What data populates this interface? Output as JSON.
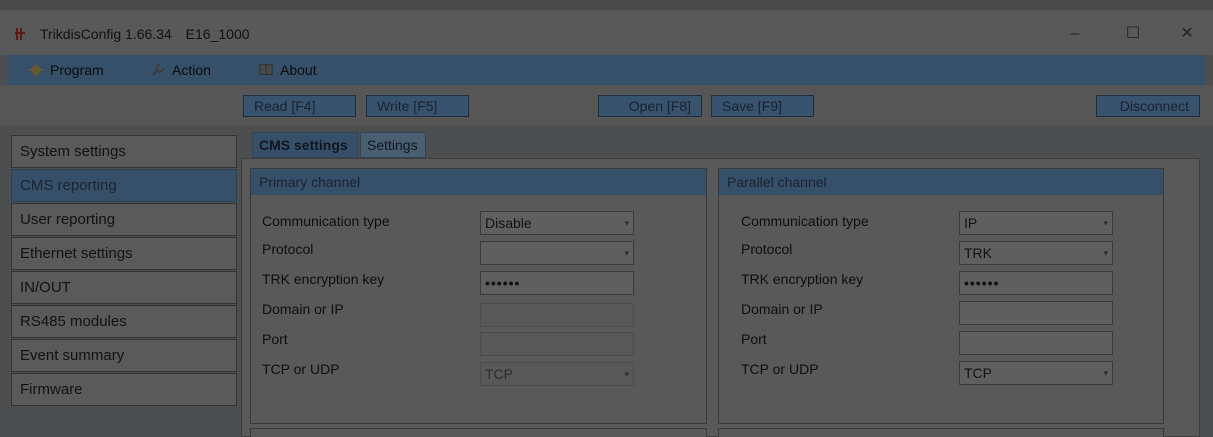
{
  "window": {
    "title": "TrikdisConfig 1.66.34",
    "device": "E16_1000",
    "controls": {
      "minimize": "–",
      "maximize": "☐",
      "close": "✕"
    }
  },
  "menu": {
    "program": "Program",
    "action": "Action",
    "about": "About"
  },
  "toolbar": {
    "read": "Read [F4]",
    "write": "Write [F5]",
    "open": "Open [F8]",
    "save": "Save [F9]",
    "disconnect": "Disconnect"
  },
  "sidebar": {
    "items": [
      {
        "label": "System settings"
      },
      {
        "label": "CMS reporting"
      },
      {
        "label": "User reporting"
      },
      {
        "label": "Ethernet settings"
      },
      {
        "label": "IN/OUT"
      },
      {
        "label": "RS485 modules"
      },
      {
        "label": "Event summary"
      },
      {
        "label": "Firmware"
      }
    ],
    "active_index": 1
  },
  "tabs": {
    "cms_settings": "CMS settings",
    "settings": "Settings"
  },
  "primary": {
    "title": "Primary channel",
    "labels": {
      "comm_type": "Communication type",
      "protocol": "Protocol",
      "enc_key": "TRK encryption key",
      "domain": "Domain or IP",
      "port": "Port",
      "tcp_udp": "TCP or UDP"
    },
    "values": {
      "comm_type": "Disable",
      "protocol": "",
      "enc_key": "••••••",
      "domain": "",
      "port": "",
      "tcp_udp": "TCP"
    }
  },
  "parallel": {
    "title": "Parallel channel",
    "labels": {
      "comm_type": "Communication type",
      "protocol": "Protocol",
      "enc_key": "TRK encryption key",
      "domain": "Domain or IP",
      "port": "Port",
      "tcp_udp": "TCP or UDP"
    },
    "values": {
      "comm_type": "IP",
      "protocol": "TRK",
      "enc_key": "••••••",
      "domain": "",
      "port": "",
      "tcp_udp": "TCP"
    }
  },
  "icons": {
    "app": "trikdis-app-icon",
    "program": "gear-icon",
    "action": "wrench-icon",
    "about": "book-icon",
    "dropdown": "chevron-down-icon"
  },
  "colors": {
    "accent": "#37506a",
    "window_bg": "#595959"
  }
}
